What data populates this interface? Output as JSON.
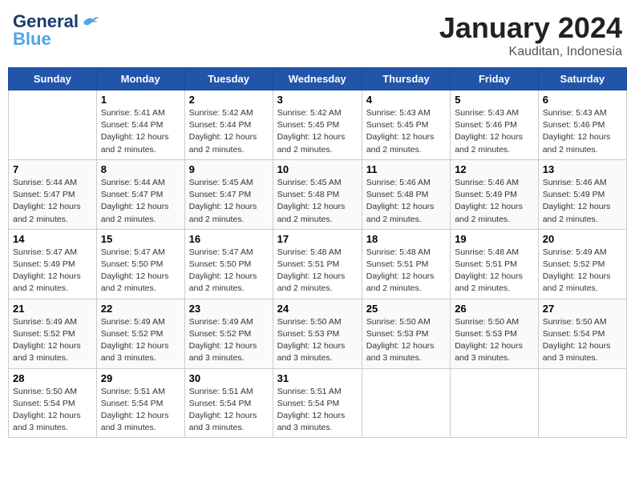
{
  "header": {
    "logo_line1": "General",
    "logo_line2": "Blue",
    "month": "January 2024",
    "location": "Kauditan, Indonesia"
  },
  "days_of_week": [
    "Sunday",
    "Monday",
    "Tuesday",
    "Wednesday",
    "Thursday",
    "Friday",
    "Saturday"
  ],
  "weeks": [
    [
      {
        "day": "",
        "sunrise": "",
        "sunset": "",
        "daylight": ""
      },
      {
        "day": "1",
        "sunrise": "5:41 AM",
        "sunset": "5:44 PM",
        "daylight": "12 hours and 2 minutes."
      },
      {
        "day": "2",
        "sunrise": "5:42 AM",
        "sunset": "5:44 PM",
        "daylight": "12 hours and 2 minutes."
      },
      {
        "day": "3",
        "sunrise": "5:42 AM",
        "sunset": "5:45 PM",
        "daylight": "12 hours and 2 minutes."
      },
      {
        "day": "4",
        "sunrise": "5:43 AM",
        "sunset": "5:45 PM",
        "daylight": "12 hours and 2 minutes."
      },
      {
        "day": "5",
        "sunrise": "5:43 AM",
        "sunset": "5:46 PM",
        "daylight": "12 hours and 2 minutes."
      },
      {
        "day": "6",
        "sunrise": "5:43 AM",
        "sunset": "5:46 PM",
        "daylight": "12 hours and 2 minutes."
      }
    ],
    [
      {
        "day": "7",
        "sunrise": "5:44 AM",
        "sunset": "5:47 PM",
        "daylight": "12 hours and 2 minutes."
      },
      {
        "day": "8",
        "sunrise": "5:44 AM",
        "sunset": "5:47 PM",
        "daylight": "12 hours and 2 minutes."
      },
      {
        "day": "9",
        "sunrise": "5:45 AM",
        "sunset": "5:47 PM",
        "daylight": "12 hours and 2 minutes."
      },
      {
        "day": "10",
        "sunrise": "5:45 AM",
        "sunset": "5:48 PM",
        "daylight": "12 hours and 2 minutes."
      },
      {
        "day": "11",
        "sunrise": "5:46 AM",
        "sunset": "5:48 PM",
        "daylight": "12 hours and 2 minutes."
      },
      {
        "day": "12",
        "sunrise": "5:46 AM",
        "sunset": "5:49 PM",
        "daylight": "12 hours and 2 minutes."
      },
      {
        "day": "13",
        "sunrise": "5:46 AM",
        "sunset": "5:49 PM",
        "daylight": "12 hours and 2 minutes."
      }
    ],
    [
      {
        "day": "14",
        "sunrise": "5:47 AM",
        "sunset": "5:49 PM",
        "daylight": "12 hours and 2 minutes."
      },
      {
        "day": "15",
        "sunrise": "5:47 AM",
        "sunset": "5:50 PM",
        "daylight": "12 hours and 2 minutes."
      },
      {
        "day": "16",
        "sunrise": "5:47 AM",
        "sunset": "5:50 PM",
        "daylight": "12 hours and 2 minutes."
      },
      {
        "day": "17",
        "sunrise": "5:48 AM",
        "sunset": "5:51 PM",
        "daylight": "12 hours and 2 minutes."
      },
      {
        "day": "18",
        "sunrise": "5:48 AM",
        "sunset": "5:51 PM",
        "daylight": "12 hours and 2 minutes."
      },
      {
        "day": "19",
        "sunrise": "5:48 AM",
        "sunset": "5:51 PM",
        "daylight": "12 hours and 2 minutes."
      },
      {
        "day": "20",
        "sunrise": "5:49 AM",
        "sunset": "5:52 PM",
        "daylight": "12 hours and 2 minutes."
      }
    ],
    [
      {
        "day": "21",
        "sunrise": "5:49 AM",
        "sunset": "5:52 PM",
        "daylight": "12 hours and 3 minutes."
      },
      {
        "day": "22",
        "sunrise": "5:49 AM",
        "sunset": "5:52 PM",
        "daylight": "12 hours and 3 minutes."
      },
      {
        "day": "23",
        "sunrise": "5:49 AM",
        "sunset": "5:52 PM",
        "daylight": "12 hours and 3 minutes."
      },
      {
        "day": "24",
        "sunrise": "5:50 AM",
        "sunset": "5:53 PM",
        "daylight": "12 hours and 3 minutes."
      },
      {
        "day": "25",
        "sunrise": "5:50 AM",
        "sunset": "5:53 PM",
        "daylight": "12 hours and 3 minutes."
      },
      {
        "day": "26",
        "sunrise": "5:50 AM",
        "sunset": "5:53 PM",
        "daylight": "12 hours and 3 minutes."
      },
      {
        "day": "27",
        "sunrise": "5:50 AM",
        "sunset": "5:54 PM",
        "daylight": "12 hours and 3 minutes."
      }
    ],
    [
      {
        "day": "28",
        "sunrise": "5:50 AM",
        "sunset": "5:54 PM",
        "daylight": "12 hours and 3 minutes."
      },
      {
        "day": "29",
        "sunrise": "5:51 AM",
        "sunset": "5:54 PM",
        "daylight": "12 hours and 3 minutes."
      },
      {
        "day": "30",
        "sunrise": "5:51 AM",
        "sunset": "5:54 PM",
        "daylight": "12 hours and 3 minutes."
      },
      {
        "day": "31",
        "sunrise": "5:51 AM",
        "sunset": "5:54 PM",
        "daylight": "12 hours and 3 minutes."
      },
      {
        "day": "",
        "sunrise": "",
        "sunset": "",
        "daylight": ""
      },
      {
        "day": "",
        "sunrise": "",
        "sunset": "",
        "daylight": ""
      },
      {
        "day": "",
        "sunrise": "",
        "sunset": "",
        "daylight": ""
      }
    ]
  ],
  "labels": {
    "sunrise": "Sunrise:",
    "sunset": "Sunset:",
    "daylight": "Daylight:"
  }
}
